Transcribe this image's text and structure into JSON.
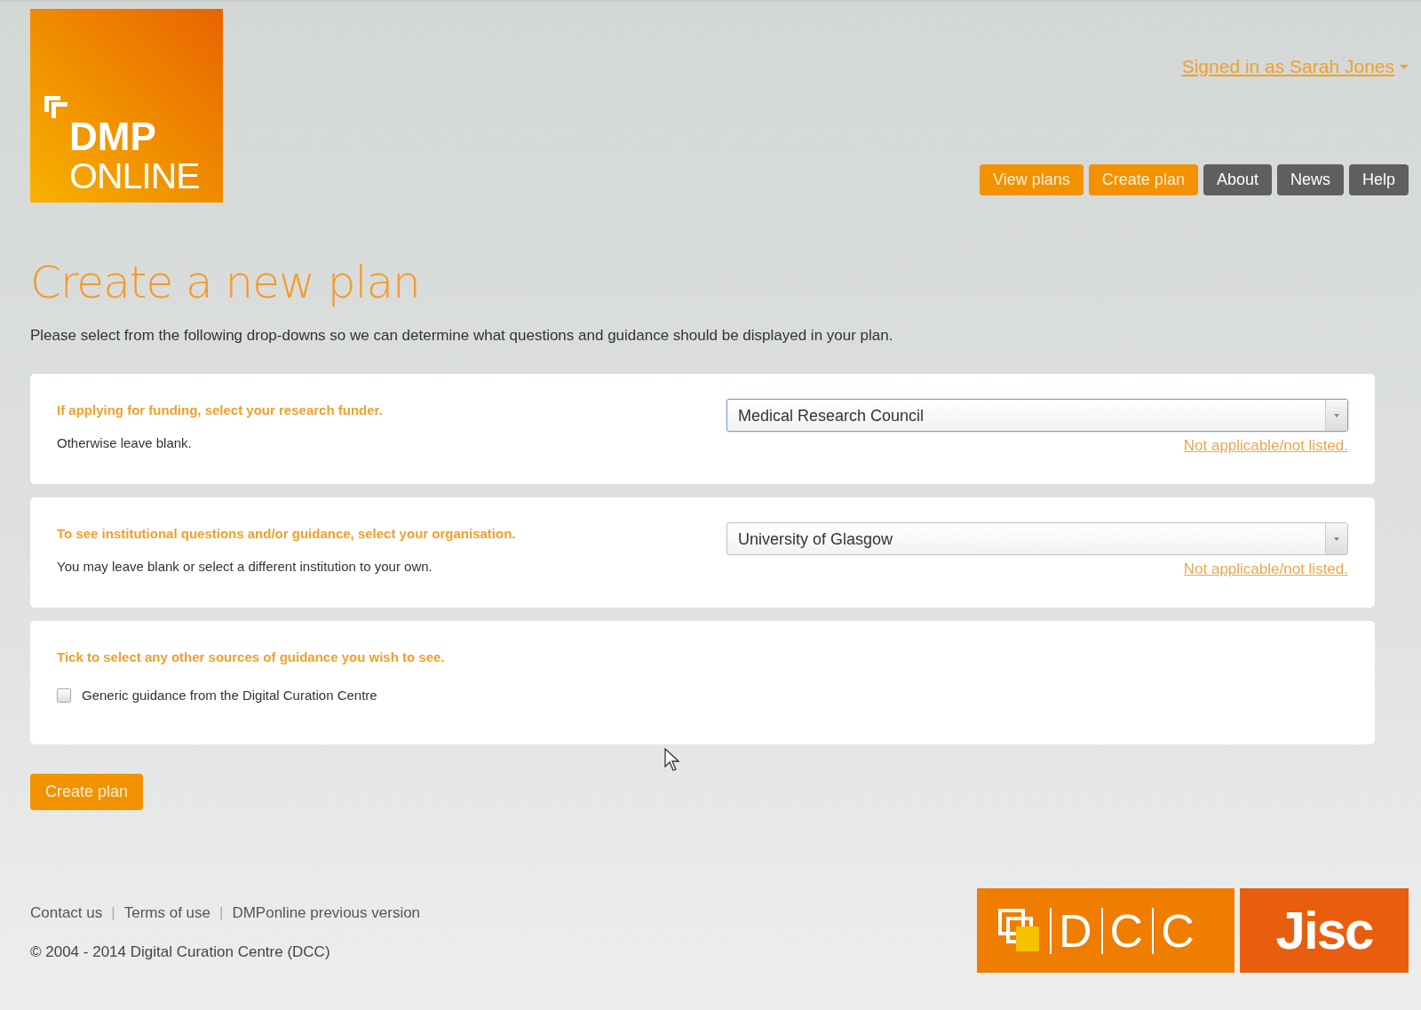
{
  "header": {
    "logo": {
      "line_1": "DMP",
      "line_2": "ONLINE"
    },
    "user_menu": {
      "label": "Signed in as Sarah Jones "
    },
    "nav": [
      {
        "label": "View plans",
        "kind": "primary"
      },
      {
        "label": "Create plan",
        "kind": "primary"
      },
      {
        "label": "About",
        "kind": "secondary"
      },
      {
        "label": "News",
        "kind": "secondary"
      },
      {
        "label": "Help",
        "kind": "secondary"
      }
    ]
  },
  "page_title": "Create a new plan",
  "intro": "Please select from the following drop-downs so we can determine what questions and guidance should be displayed in your plan.",
  "sections": [
    {
      "kind": "select",
      "heading": "If applying for funding, select your research funder.",
      "hint": "Otherwise leave blank.",
      "value": "Medical Research Council",
      "focused": true,
      "link": "Not applicable/not listed."
    },
    {
      "kind": "select",
      "heading": "To see institutional questions and/or guidance, select your organisation.",
      "hint": "You may leave blank or select a different institution to your own.",
      "value": "University of Glasgow",
      "focused": false,
      "link": "Not applicable/not listed."
    },
    {
      "kind": "checkboxes",
      "heading": "Tick to select any other sources of guidance you wish to see.",
      "options": [
        {
          "label": "Generic guidance from the Digital Curation Centre",
          "checked": false
        }
      ]
    }
  ],
  "submit": {
    "label": "Create plan"
  },
  "footer": {
    "links": [
      "Contact us",
      "|",
      "Terms of use",
      "|",
      "DMPonline previous version"
    ],
    "copyright": "© 2004 - 2014 Digital Curation Centre (DCC)",
    "partner_logos": [
      {
        "kind": "dcc",
        "letters": [
          "D",
          "C",
          "C"
        ]
      },
      {
        "kind": "jisc",
        "text": "Jisc"
      }
    ]
  }
}
